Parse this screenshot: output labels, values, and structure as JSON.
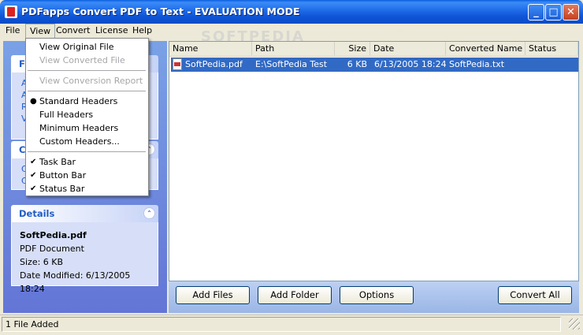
{
  "window": {
    "title": "PDFapps Convert PDF to Text - EVALUATION MODE",
    "minimize_glyph": "_",
    "maximize_glyph": "□",
    "close_glyph": "✕"
  },
  "menubar": {
    "items": [
      {
        "label": "File"
      },
      {
        "label": "View"
      },
      {
        "label": "Convert"
      },
      {
        "label": "License"
      },
      {
        "label": "Help"
      }
    ]
  },
  "view_menu": {
    "view_original": "View Original File",
    "view_converted": "View Converted File",
    "view_report": "View Conversion Report",
    "standard_headers": "Standard Headers",
    "full_headers": "Full Headers",
    "minimum_headers": "Minimum Headers",
    "custom_headers": "Custom Headers...",
    "task_bar": "Task Bar",
    "button_bar": "Button Bar",
    "status_bar": "Status Bar",
    "bullet": "●",
    "check": "✔"
  },
  "left_panel": {
    "group1_title": "F",
    "group1_links": [
      "A",
      "A",
      "R",
      "V"
    ],
    "group2_title": "C",
    "group2_links": [
      "C",
      "C"
    ],
    "details": {
      "title": "Details",
      "filename": "SoftPedia.pdf",
      "type": "PDF Document",
      "size": "Size: 6 KB",
      "modified": "Date Modified: 6/13/2005 18:24"
    },
    "chevron": "⌃"
  },
  "file_list": {
    "columns": [
      "Name",
      "Path",
      "Size",
      "Date",
      "Converted Name",
      "Status"
    ],
    "rows": [
      {
        "name": "SoftPedia.pdf",
        "path": "E:\\SoftPedia Test",
        "size": "6 KB",
        "date": "6/13/2005 18:24",
        "converted_name": "SoftPedia.txt",
        "status": ""
      }
    ],
    "watermark": "SOFTPEDIA"
  },
  "buttons": {
    "add_files": "Add Files",
    "add_folder": "Add Folder",
    "options": "Options",
    "convert_all": "Convert All"
  },
  "statusbar": {
    "text": "1 File Added"
  }
}
